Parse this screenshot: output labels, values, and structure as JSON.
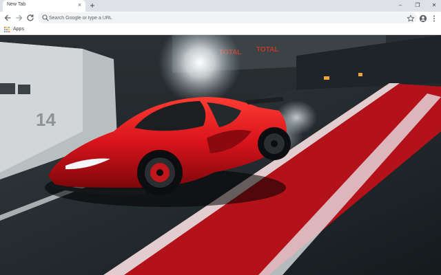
{
  "browser": {
    "tab": {
      "title": "New Tab",
      "close_glyph": "×"
    },
    "new_tab_glyph": "+",
    "window_controls": {
      "minimize": "–",
      "maximize": "❐",
      "close": "✕"
    },
    "omnibox": {
      "placeholder": "Search Google or type a URL",
      "value": ""
    },
    "bookmarks": {
      "apps_label": "Apps"
    }
  },
  "wallpaper": {
    "subject": "red-sports-car-on-pit-lane",
    "pit_number": "14",
    "signage_text": "TOTAL",
    "colors": {
      "car_red": "#d8131b",
      "track_red": "#b3121a",
      "asphalt": "#1c2226",
      "wall_light": "#c9ccce"
    }
  },
  "icons": {
    "back": "arrow-left-icon",
    "forward": "arrow-right-icon",
    "reload": "reload-icon",
    "search": "search-icon",
    "bookmark": "star-icon",
    "profile": "account-circle-icon",
    "menu": "kebab-menu-icon",
    "apps": "apps-grid-icon"
  }
}
